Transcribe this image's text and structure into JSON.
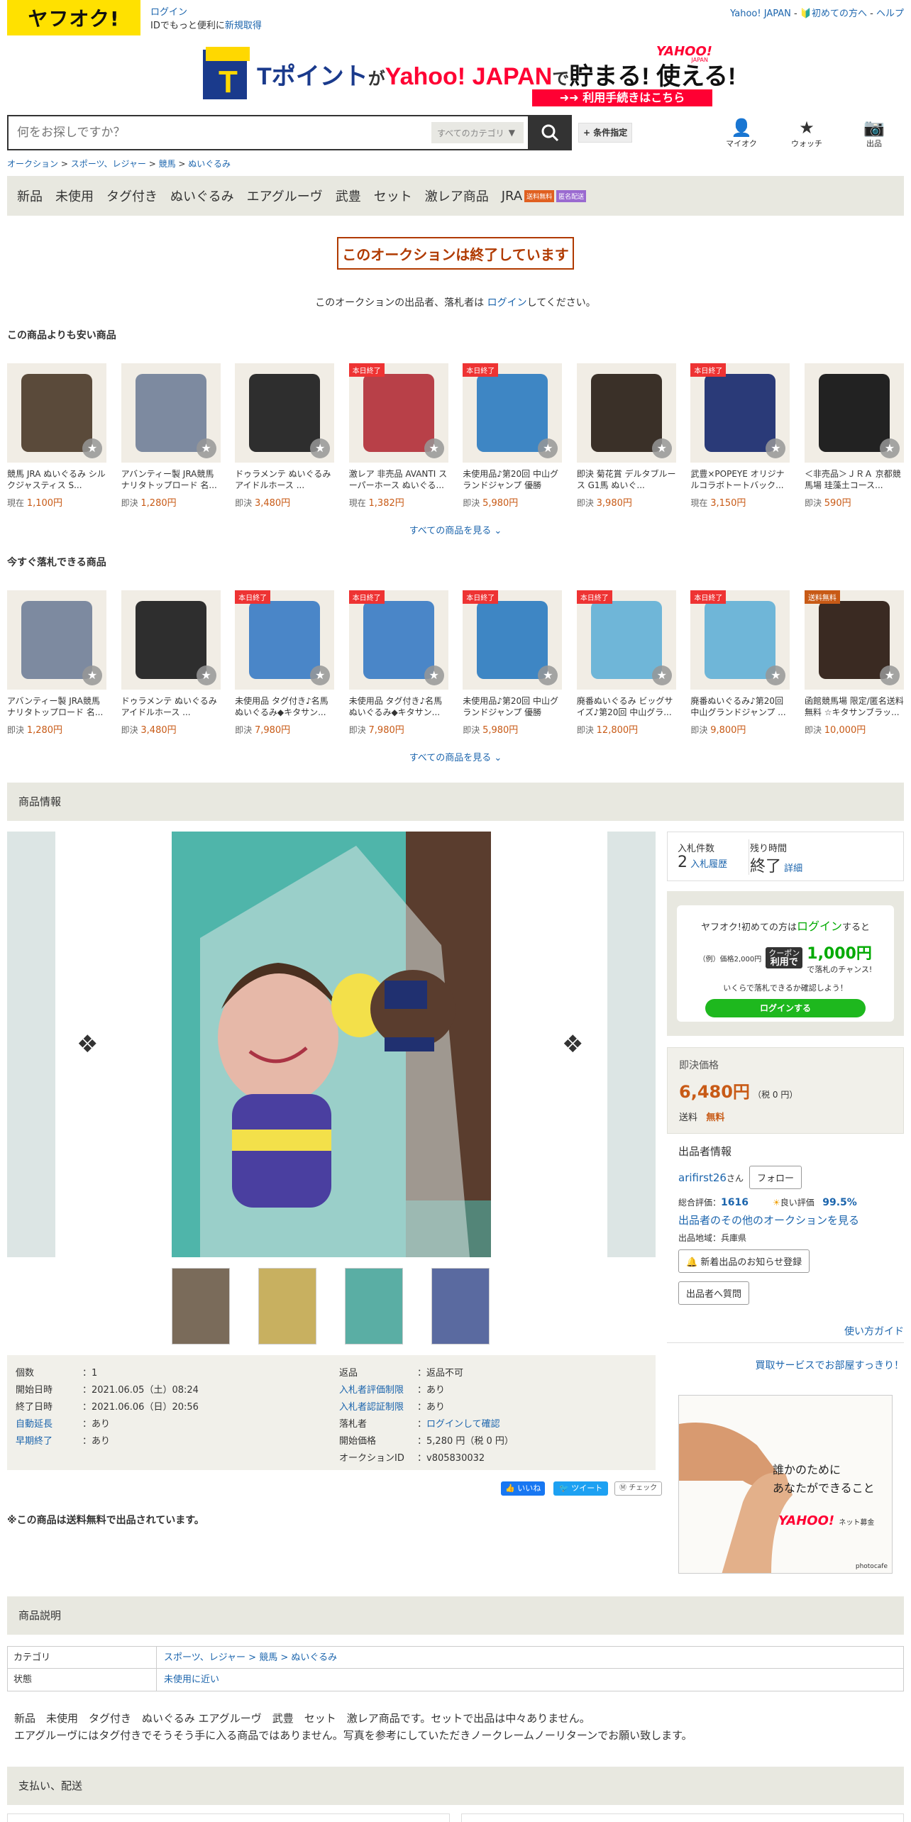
{
  "header": {
    "logo_text": "ヤフオク!",
    "login_link": "ログイン",
    "login_sub_prefix": "IDでもっと便利に",
    "signup_link": "新規取得",
    "yahoo_link": "Yahoo! JAPAN",
    "beginner_link": "初めての方へ",
    "help_link": "ヘルプ",
    "search_placeholder": "何をお探しですか？",
    "category_select": "すべてのカテゴリ",
    "condition_button": "+ 条件指定",
    "icons": {
      "myauction": "マイオク",
      "watch": "ウォッチ",
      "sell": "出品"
    }
  },
  "banner": {
    "t_point": "Tポイント",
    "ga": "が",
    "yahoo": "Yahoo! JAPAN",
    "de": "で",
    "slogan": "貯まる! 使える!",
    "yahoo_small": "YAHOO!",
    "japan_small": "JAPAN",
    "procedure": "利用手続きはこちら"
  },
  "breadcrumb": [
    "オークション",
    "スポーツ、レジャー",
    "競馬",
    "ぬいぐるみ"
  ],
  "tags": [
    "新品",
    "未使用",
    "タグ付き",
    "ぬいぐるみ",
    "エアグルーヴ",
    "武豊",
    "セット",
    "激レア商品",
    "JRA"
  ],
  "tag_badges": {
    "free": "送料無料",
    "anon": "匿名配送"
  },
  "ended_notice": "このオークションは終了しています",
  "ended_note_prefix": "このオークションの出品者、落札者は",
  "ended_note_link": "ログイン",
  "ended_note_suffix": "してください。",
  "cheaper": {
    "title": "この商品よりも安い商品",
    "see_all": "すべての商品を見る",
    "items": [
      {
        "title": "競馬 JRA ぬいぐるみ シルクジャスティス S...",
        "price_label": "現在",
        "price": "1,100円",
        "tag": "",
        "color": "#5a4a3a"
      },
      {
        "title": "アバンティー製 JRA競馬 ナリタトップロード 名...",
        "price_label": "即決",
        "price": "1,280円",
        "tag": "",
        "color": "#7d8aa0"
      },
      {
        "title": "ドゥラメンテ ぬいぐるみ アイドルホース ...",
        "price_label": "即決",
        "price": "3,480円",
        "tag": "",
        "color": "#2e2e2e"
      },
      {
        "title": "激レア 非売品 AVANTI スーパーホース ぬいぐる...",
        "price_label": "現在",
        "price": "1,382円",
        "tag": "本日終了",
        "color": "#b84048"
      },
      {
        "title": "未使用品♪第20回 中山グランドジャンプ 優勝Ver...",
        "price_label": "即決",
        "price": "5,980円",
        "tag": "本日終了",
        "color": "#3e86c4"
      },
      {
        "title": "即決 菊花賞 デルタブルース G1馬 ぬいぐ...",
        "price_label": "即決",
        "price": "3,980円",
        "tag": "",
        "color": "#3a3028"
      },
      {
        "title": "武豊×POPEYE オリジナルコラボトートバック...",
        "price_label": "現在",
        "price": "3,150円",
        "tag": "本日終了",
        "color": "#2a3a78"
      },
      {
        "title": "＜非売品＞ＪＲＡ 京都競馬場 珪藻土コース...",
        "price_label": "即決",
        "price": "590円",
        "tag": "",
        "color": "#222222"
      }
    ]
  },
  "buynow": {
    "title": "今すぐ落札できる商品",
    "see_all": "すべての商品を見る",
    "items": [
      {
        "title": "アバンティー製 JRA競馬 ナリタトップロード 名...",
        "price_label": "即決",
        "price": "1,280円",
        "tag": "",
        "color": "#7d8aa0"
      },
      {
        "title": "ドゥラメンテ ぬいぐるみ アイドルホース ...",
        "price_label": "即決",
        "price": "3,480円",
        "tag": "",
        "color": "#2e2e2e"
      },
      {
        "title": "未使用品 タグ付き♪名馬ぬいぐるみ◆キタサン...",
        "price_label": "即決",
        "price": "7,980円",
        "tag": "本日終了",
        "color": "#4a86c8"
      },
      {
        "title": "未使用品 タグ付き♪名馬ぬいぐるみ◆キタサン...",
        "price_label": "即決",
        "price": "7,980円",
        "tag": "本日終了",
        "color": "#4a86c8"
      },
      {
        "title": "未使用品♪第20回 中山グランドジャンプ 優勝Ver...",
        "price_label": "即決",
        "price": "5,980円",
        "tag": "本日終了",
        "color": "#3e86c4"
      },
      {
        "title": "廃番ぬいぐるみ ビッグサイズ♪第20回 中山グラ...",
        "price_label": "即決",
        "price": "12,800円",
        "tag": "本日終了",
        "color": "#6fb6d8"
      },
      {
        "title": "廃番ぬいぐるみ♪第20回 中山グランドジャンプ ...",
        "price_label": "即決",
        "price": "9,800円",
        "tag": "本日終了",
        "color": "#6fb6d8"
      },
      {
        "title": "函館競馬場 限定/匿名送料無料 ☆キタサンブラッ...",
        "price_label": "即決",
        "price": "10,000円",
        "tag": "送料無料",
        "color": "#3a2a22"
      }
    ]
  },
  "product_info_title": "商品情報",
  "info": {
    "left": [
      {
        "k": "個数",
        "v": "1",
        "k_link": false
      },
      {
        "k": "開始日時",
        "v": "2021.06.05（土）08:24",
        "k_link": false
      },
      {
        "k": "終了日時",
        "v": "2021.06.06（日）20:56",
        "k_link": false
      },
      {
        "k": "自動延長",
        "v": "あり",
        "k_link": true
      },
      {
        "k": "早期終了",
        "v": "あり",
        "k_link": true
      }
    ],
    "right": [
      {
        "k": "返品",
        "v": "返品不可",
        "k_link": false
      },
      {
        "k": "入札者評価制限",
        "v": "あり",
        "k_link": true
      },
      {
        "k": "入札者認証制限",
        "v": "あり",
        "k_link": true
      },
      {
        "k": "落札者",
        "v": "ログインして確認",
        "k_link": false
      },
      {
        "k": "開始価格",
        "v": "5,280 円（税 0 円）",
        "k_link": false
      },
      {
        "k": "オークションID",
        "v": "v805830032",
        "k_link": false
      }
    ]
  },
  "social": {
    "like": "いいね",
    "tweet": "ツイート",
    "check": "チェック"
  },
  "free_shipping_note": "※この商品は送料無料で出品されています。",
  "bid": {
    "count_label": "入札件数",
    "count": "2",
    "history": "入札履歴",
    "remain_label": "残り時間",
    "remain": "終了",
    "detail": "詳細"
  },
  "promo": {
    "line1_prefix": "ヤフオク!初めての方は",
    "line1_link": "ログイン",
    "line1_suffix": "すると",
    "example": "（例）価格2,000円",
    "coupon_top": "クーポン",
    "coupon_bottom": "利用で",
    "amount": "1,000円",
    "chance": "で落札のチャンス!",
    "question": "いくらで落札できるか確認しよう！",
    "login_button": "ログインする"
  },
  "buynow_price": {
    "label": "即決価格",
    "price": "6,480円",
    "tax": "（税 0 円）",
    "shipping_label": "送料",
    "shipping": "無料"
  },
  "seller": {
    "title": "出品者情報",
    "name": "arifirst26",
    "suffix": "さん",
    "follow": "フォロー",
    "rating_label": "総合評価：",
    "rating": "1616",
    "good_label": "良い評価",
    "good": "99.5%",
    "other_link": "出品者のその他のオークションを見る",
    "region": "出品地域：兵庫県",
    "notify_button": "新着出品のお知らせ登録",
    "ask_button": "出品者へ質問"
  },
  "guide_link": "使い方ガイド",
  "buy_service_link": "買取サービスでお部屋すっきり！",
  "ad": {
    "line1": "誰かのために",
    "line2": "あなたができること",
    "brand": "YAHOO!",
    "brand_sub": "ネット募金",
    "credit": "photocafe"
  },
  "description_title": "商品説明",
  "desc_table": [
    {
      "k": "カテゴリ",
      "v": "スポーツ、レジャー > 競馬 > ぬいぐるみ"
    },
    {
      "k": "状態",
      "v": "未使用に近い"
    }
  ],
  "desc_text1": "新品　未使用　タグ付き　ぬいぐるみ エアグルーヴ　武豊　セット　激レア商品です。セットで出品は中々ありません。",
  "desc_text2": "エアグルーヴにはタグ付きでそうそう手に入る商品ではありません。写真を参考にしていただきノークレームノーリターンでお願い致します。",
  "payment_title": "支払い、配送"
}
